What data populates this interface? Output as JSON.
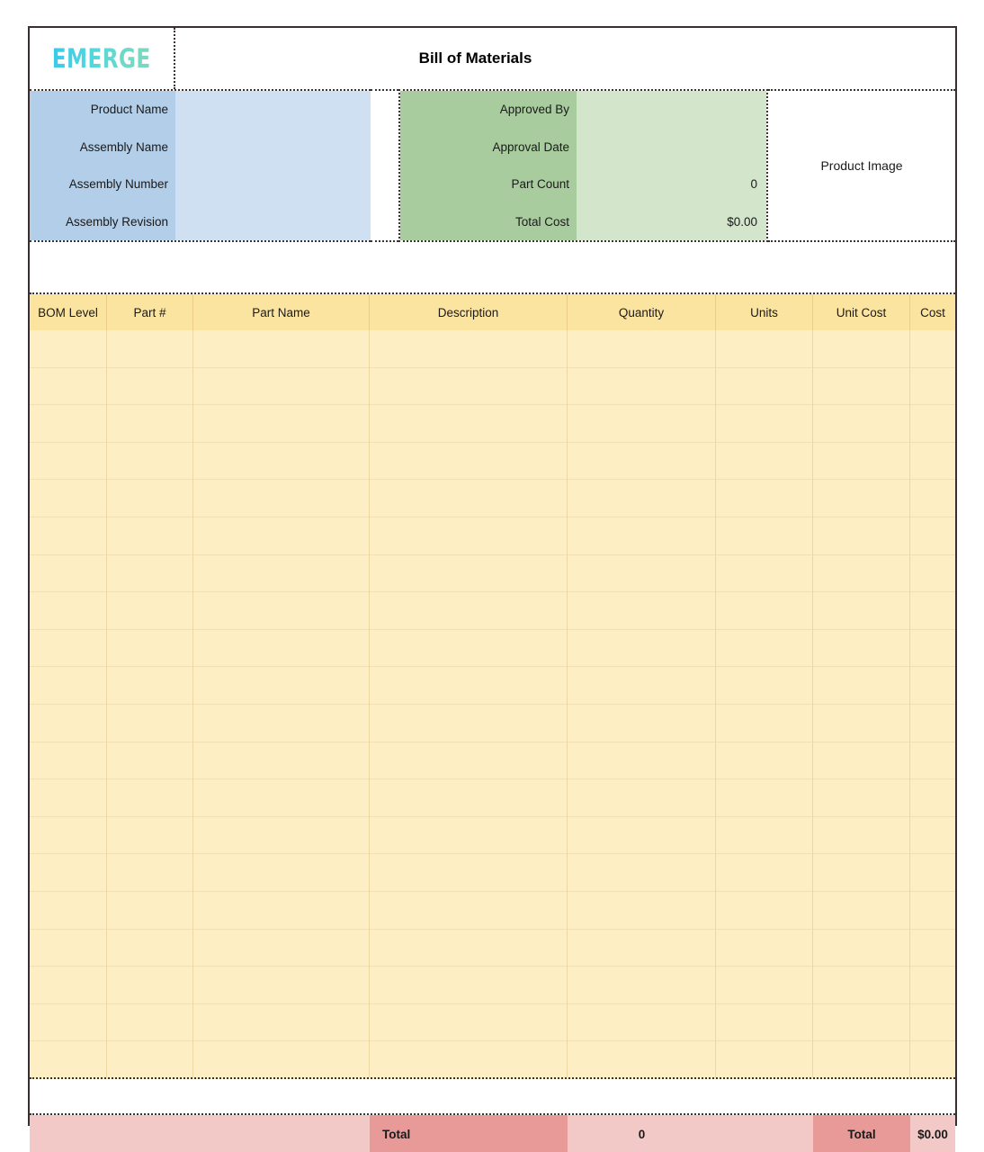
{
  "document": {
    "logo_text": "EMERGE",
    "title": "Bill of Materials"
  },
  "info": {
    "left_block": [
      {
        "label": "Product Name",
        "value": ""
      },
      {
        "label": "Assembly Name",
        "value": ""
      },
      {
        "label": "Assembly Number",
        "value": ""
      },
      {
        "label": "Assembly Revision",
        "value": ""
      }
    ],
    "right_block": [
      {
        "label": "Approved By",
        "value": ""
      },
      {
        "label": "Approval Date",
        "value": ""
      },
      {
        "label": "Part Count",
        "value": "0"
      },
      {
        "label": "Total Cost",
        "value": "$0.00"
      }
    ],
    "image_placeholder": "Product Image"
  },
  "table": {
    "columns": [
      "BOM Level",
      "Part #",
      "Part Name",
      "Description",
      "Quantity",
      "Units",
      "Unit Cost",
      "Cost"
    ],
    "rows": []
  },
  "footer": {
    "total_label_quantity": "Total",
    "total_quantity": "0",
    "total_label_cost": "Total",
    "total_cost": "$0.00"
  },
  "colors": {
    "blue_label": "#b2cee9",
    "blue_value": "#cfe0f3",
    "green_label": "#a8cc9d",
    "green_value": "#d3e5cb",
    "table_header": "#fbe3a0",
    "table_body": "#fdeec4",
    "total_band": "#f2c9c6",
    "total_accent": "#e79a97",
    "frame_border": "#3a2f2e",
    "logo_gradient_start": "#39c8e8",
    "logo_gradient_end": "#7fd6bd"
  }
}
